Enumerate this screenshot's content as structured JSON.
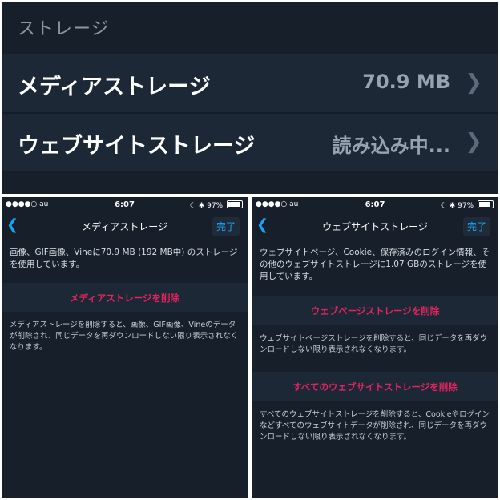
{
  "top": {
    "header": "ストレージ",
    "rows": [
      {
        "label": "メディアストレージ",
        "value": "70.9 MB"
      },
      {
        "label": "ウェブサイトストレージ",
        "value": "読み込み中..."
      }
    ]
  },
  "status_bar": {
    "carrier": "●●●●○ au",
    "time": "6:07",
    "battery": "97%"
  },
  "left_screen": {
    "title": "メディアストレージ",
    "done": "完了",
    "description": "画像、GIF画像、Vineに70.9 MB (192 MB中) のストレージを使用しています。",
    "action": "メディアストレージを削除",
    "note": "メディアストレージを削除すると、画像、GIF画像、Vineのデータが削除され、同じデータを再ダウンロードしない限り表示されなくなります。"
  },
  "right_screen": {
    "title": "ウェブサイトストレージ",
    "done": "完了",
    "description": "ウェブサイトページ、Cookie、保存済みのログイン情報、その他のウェブサイトストレージに1.07 GBのストレージを使用しています。",
    "action1": "ウェブページストレージを削除",
    "note1": "ウェブサイトページストレージを削除すると、同じデータを再ダウンロードしない限り表示されなくなります。",
    "action2": "すべてのウェブサイトストレージを削除",
    "note2": "すべてのウェブサイトストレージを削除すると、Cookieやログインなどすべてのウェブサイトデータが削除され、同じデータを再ダウンロードしない限り表示されなくなります。"
  },
  "colors": {
    "background": "#161f2a",
    "row": "#1d2836",
    "accent": "#1da1f2",
    "destructive": "#e0245e"
  }
}
